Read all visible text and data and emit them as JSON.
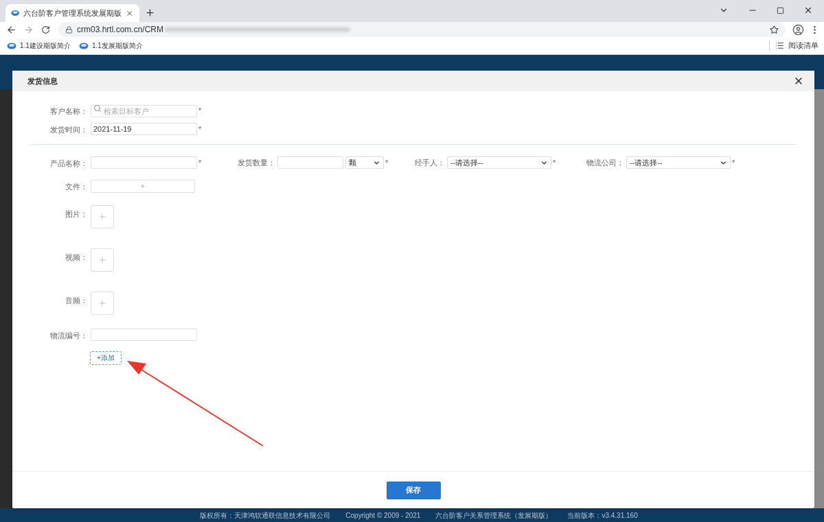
{
  "browser": {
    "tab_title": "六台阶客户管理系统发展期版",
    "url": "crm03.hrtl.com.cn/CRM",
    "bookmarks": [
      "1.1建设期版简介",
      "1.1发展期版简介"
    ],
    "reading_list": "阅读清单"
  },
  "dialog": {
    "title": "发货信息",
    "top_fields": [
      {
        "kind": "search",
        "label": "客户名称：",
        "placeholder": "检索目标客户",
        "required_mark": "*"
      },
      {
        "kind": "text",
        "label": "发货时间：",
        "value": "2021-11-19",
        "required_mark": "*"
      }
    ],
    "row_fields": [
      {
        "kind": "text",
        "label": "产品名称：",
        "required_mark": "*"
      },
      {
        "kind": "text_unit",
        "label": "发货数量：",
        "unit": "颗",
        "required_mark": "*"
      },
      {
        "kind": "select",
        "label": "经手人：",
        "value": "--请选择--",
        "required_mark": "*"
      },
      {
        "kind": "select",
        "label": "物流公司：",
        "value": "--请选择--",
        "required_mark": "*"
      }
    ],
    "file": {
      "label": "文件：",
      "button": "+"
    },
    "uploads": [
      {
        "label": "图片："
      },
      {
        "label": "视频："
      },
      {
        "label": "音频："
      }
    ],
    "tracking": {
      "label": "物流编号："
    },
    "add_button": "+添加",
    "save_button": "保存"
  },
  "footer": [
    "版权所有：天津鸿软通联信息技术有限公司",
    "Copyright © 2009 - 2021",
    "六台阶客户关系管理系统（发展期版）",
    "当前版本：v3.4.31.160"
  ]
}
